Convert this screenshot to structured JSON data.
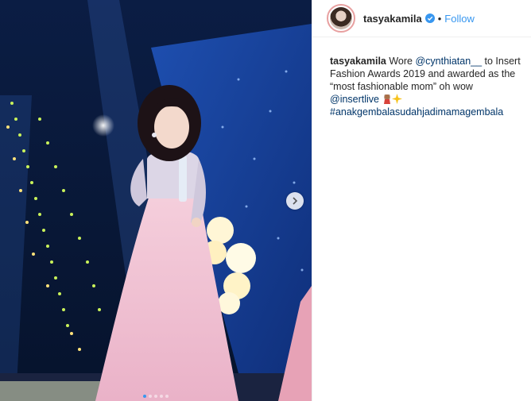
{
  "post": {
    "media": {
      "carousel": {
        "total_slides": 5,
        "active_index": 0
      }
    }
  },
  "header": {
    "username": "tasyakamila",
    "separator": "•",
    "follow_label": "Follow"
  },
  "caption": {
    "username": "tasyakamila",
    "text_1": " Wore ",
    "mention_1": "@cynthiatan__",
    "text_2": " to Insert Fashion Awards 2019 and awarded as the “most fashionable mom” oh wow ",
    "mention_2": "@insertlive",
    "hashtag": "#anakgembalasudahjadimamagembala"
  },
  "colors": {
    "link": "#003569",
    "follow": "#3897f0",
    "verified": "#3897f0"
  },
  "icons": {
    "next": "chevron-right-icon",
    "verified": "verified-badge-icon"
  }
}
